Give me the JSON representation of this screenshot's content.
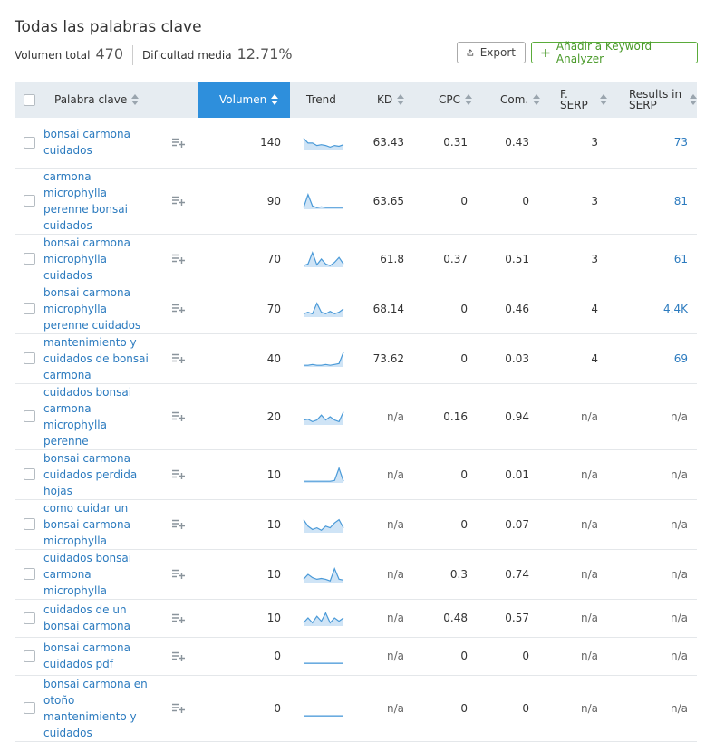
{
  "title": "Todas las palabras clave",
  "stats": {
    "total_label": "Volumen total",
    "total_value": "470",
    "difficulty_label": "Dificultad media",
    "difficulty_value": "12.71%"
  },
  "buttons": {
    "export": "Export",
    "keyword_analyzer": "Añadir a Keyword Analyzer"
  },
  "columns": {
    "keyword": "Palabra clave",
    "volume": "Volumen",
    "trend": "Trend",
    "kd": "KD",
    "cpc": "CPC",
    "com": "Com.",
    "fserp": "F.\nSERP",
    "results": "Results in\nSERP"
  },
  "colors": {
    "accent": "#2e8fdc",
    "link": "#2c7bbf",
    "green": "#5aab3a"
  },
  "rows": [
    {
      "keyword": "bonsai carmona cuidados",
      "volume": "140",
      "kd": "63.43",
      "cpc": "0.31",
      "com": "0.43",
      "fserp": "3",
      "results": "73",
      "trend": [
        0.75,
        0.45,
        0.45,
        0.3,
        0.35,
        0.3,
        0.2,
        0.3,
        0.25,
        0.35
      ]
    },
    {
      "keyword": "carmona microphylla perenne bonsai cuidados",
      "volume": "90",
      "kd": "63.65",
      "cpc": "0",
      "com": "0",
      "fserp": "3",
      "results": "81",
      "trend": [
        0.1,
        0.9,
        0.2,
        0.1,
        0.15,
        0.1,
        0.1,
        0.1,
        0.1,
        0.1
      ]
    },
    {
      "keyword": "bonsai carmona microphylla cuidados",
      "volume": "70",
      "kd": "61.8",
      "cpc": "0.37",
      "com": "0.51",
      "fserp": "3",
      "results": "61",
      "trend": [
        0.1,
        0.2,
        0.9,
        0.15,
        0.5,
        0.2,
        0.1,
        0.3,
        0.6,
        0.2
      ]
    },
    {
      "keyword": "bonsai carmona microphylla perenne cuidados",
      "volume": "70",
      "kd": "68.14",
      "cpc": "0",
      "com": "0.46",
      "fserp": "4",
      "results": "4.4K",
      "trend": [
        0.2,
        0.3,
        0.2,
        0.85,
        0.3,
        0.2,
        0.35,
        0.2,
        0.3,
        0.5
      ]
    },
    {
      "keyword": "mantenimiento y cuidados de bonsai carmona",
      "volume": "40",
      "kd": "73.62",
      "cpc": "0",
      "com": "0.03",
      "fserp": "4",
      "results": "69",
      "trend": [
        0.1,
        0.1,
        0.15,
        0.1,
        0.1,
        0.15,
        0.1,
        0.15,
        0.2,
        0.9
      ]
    },
    {
      "keyword": "cuidados bonsai carmona microphylla perenne",
      "volume": "20",
      "kd": "n/a",
      "cpc": "0.16",
      "com": "0.94",
      "fserp": "n/a",
      "results": "n/a",
      "trend": [
        0.3,
        0.35,
        0.2,
        0.3,
        0.6,
        0.3,
        0.5,
        0.3,
        0.2,
        0.8
      ]
    },
    {
      "keyword": "bonsai carmona cuidados perdida hojas",
      "volume": "10",
      "kd": "n/a",
      "cpc": "0",
      "com": "0.01",
      "fserp": "n/a",
      "results": "n/a",
      "trend": [
        0.1,
        0.1,
        0.1,
        0.1,
        0.1,
        0.1,
        0.1,
        0.15,
        0.9,
        0.1
      ]
    },
    {
      "keyword": "como cuidar un bonsai carmona microphylla",
      "volume": "10",
      "kd": "n/a",
      "cpc": "0",
      "com": "0.07",
      "fserp": "n/a",
      "results": "n/a",
      "trend": [
        0.8,
        0.4,
        0.2,
        0.3,
        0.15,
        0.4,
        0.3,
        0.6,
        0.8,
        0.3
      ]
    },
    {
      "keyword": "cuidados bonsai carmona microphylla",
      "volume": "10",
      "kd": "n/a",
      "cpc": "0.3",
      "com": "0.74",
      "fserp": "n/a",
      "results": "n/a",
      "trend": [
        0.2,
        0.5,
        0.3,
        0.2,
        0.25,
        0.2,
        0.1,
        0.85,
        0.2,
        0.15
      ]
    },
    {
      "keyword": "cuidados de un bonsai carmona",
      "volume": "10",
      "kd": "n/a",
      "cpc": "0.48",
      "com": "0.57",
      "fserp": "n/a",
      "results": "n/a",
      "trend": [
        0.2,
        0.5,
        0.2,
        0.6,
        0.3,
        0.8,
        0.2,
        0.5,
        0.3,
        0.5
      ]
    },
    {
      "keyword": "bonsai carmona cuidados pdf",
      "volume": "0",
      "kd": "n/a",
      "cpc": "0",
      "com": "0",
      "fserp": "n/a",
      "results": "n/a",
      "trend": [
        0.05,
        0.05,
        0.05,
        0.05,
        0.05,
        0.05,
        0.05,
        0.05,
        0.05,
        0.05
      ]
    },
    {
      "keyword": "bonsai carmona en otoño mantenimiento y cuidados",
      "volume": "0",
      "kd": "n/a",
      "cpc": "0",
      "com": "0",
      "fserp": "n/a",
      "results": "n/a",
      "trend": [
        0.05,
        0.05,
        0.05,
        0.05,
        0.05,
        0.05,
        0.05,
        0.05,
        0.05,
        0.05
      ]
    }
  ]
}
